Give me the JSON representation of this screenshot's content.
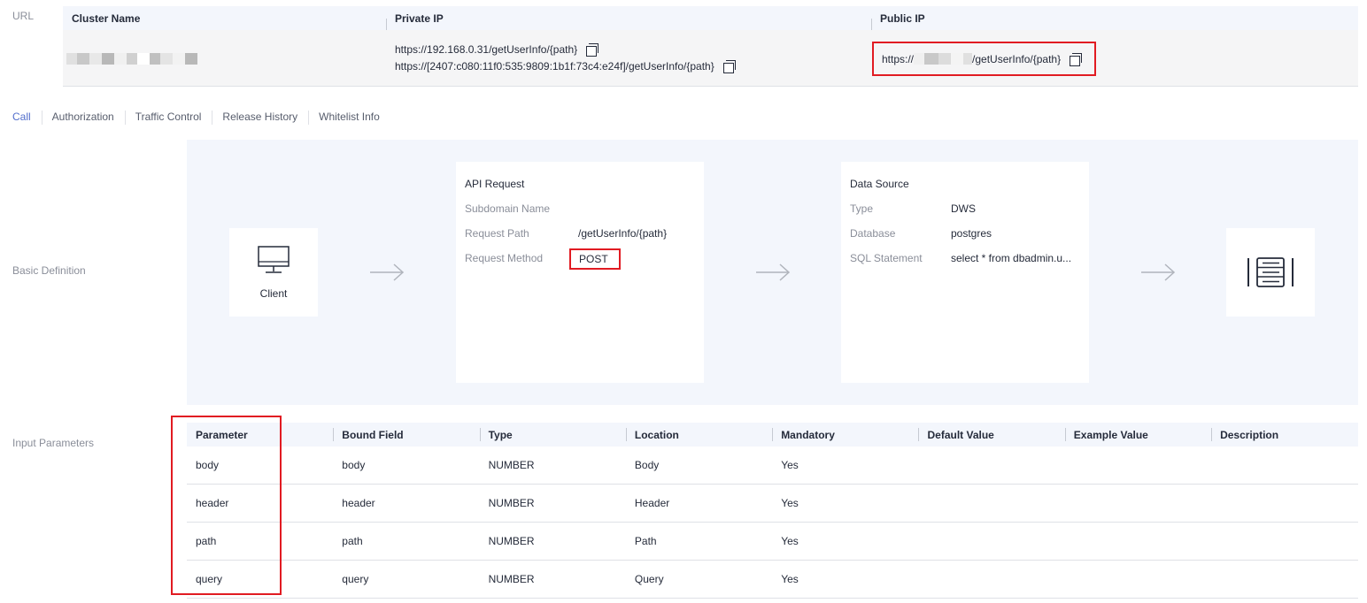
{
  "labels": {
    "url": "URL",
    "basic_definition": "Basic Definition",
    "input_parameters": "Input Parameters"
  },
  "url_table": {
    "headers": [
      "Cluster Name",
      "Private IP",
      "Public IP"
    ],
    "private_ips": [
      "https://192.168.0.31/getUserInfo/{path}",
      "https://[2407:c080:11f0:535:9809:1b1f:73c4:e24f]/getUserInfo/{path}"
    ],
    "public_ip_prefix": "https://",
    "public_ip_suffix": "/getUserInfo/{path}"
  },
  "tabs": [
    "Call",
    "Authorization",
    "Traffic Control",
    "Release History",
    "Whitelist Info"
  ],
  "active_tab": "Call",
  "diagram": {
    "client_label": "Client",
    "api_request": {
      "title": "API Request",
      "rows": [
        {
          "k": "Subdomain Name",
          "v": ""
        },
        {
          "k": "Request Path",
          "v": "/getUserInfo/{path}"
        },
        {
          "k": "Request Method",
          "v": "POST"
        }
      ]
    },
    "data_source": {
      "title": "Data Source",
      "rows": [
        {
          "k": "Type",
          "v": "DWS"
        },
        {
          "k": "Database",
          "v": "postgres"
        },
        {
          "k": "SQL Statement",
          "v": "select * from dbadmin.u..."
        }
      ]
    }
  },
  "params_table": {
    "headers": [
      "Parameter",
      "Bound Field",
      "Type",
      "Location",
      "Mandatory",
      "Default Value",
      "Example Value",
      "Description"
    ],
    "rows": [
      [
        "body",
        "body",
        "NUMBER",
        "Body",
        "Yes",
        "",
        "",
        ""
      ],
      [
        "header",
        "header",
        "NUMBER",
        "Header",
        "Yes",
        "",
        "",
        ""
      ],
      [
        "path",
        "path",
        "NUMBER",
        "Path",
        "Yes",
        "",
        "",
        ""
      ],
      [
        "query",
        "query",
        "NUMBER",
        "Query",
        "Yes",
        "",
        "",
        ""
      ]
    ]
  },
  "colors": {
    "accent": "#526ecc",
    "highlight": "#e11b22",
    "panel_bg": "#f3f6fc"
  },
  "icons": [
    "copy-icon",
    "monitor-icon",
    "arrow-right-icon",
    "database-server-icon"
  ]
}
